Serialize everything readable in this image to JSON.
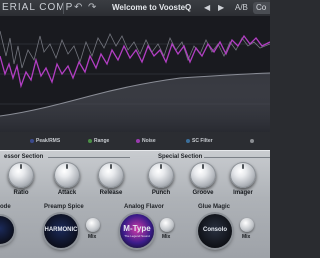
{
  "topbar": {
    "title": "ERIAL COMP",
    "undo_icon": "↶",
    "redo_icon": "↷",
    "preset": "Welcome to VoosteQ",
    "prev_icon": "◀",
    "next_icon": "▶",
    "ab_label": "A/B",
    "copy_label": "Co"
  },
  "meters": {
    "peak_label": "Peak/RMS",
    "range_label": "Range",
    "noise_label": "Noise",
    "sc_filter_label": "SC Filter",
    "colors": {
      "peak": "#3b4a8c",
      "range": "#4b8f46",
      "noise": "#9b3bb0",
      "sc": "#3b6f9b"
    }
  },
  "compressor": {
    "section_label": "essor Section",
    "knobs": [
      "Ratio",
      "Attack",
      "Release"
    ]
  },
  "special": {
    "section_label": "Special Section",
    "knobs": [
      "Punch",
      "Groove",
      "Imager"
    ]
  },
  "lower": {
    "mode_label": "ode",
    "preamp_label": "Preamp Spice",
    "analog_label": "Analog Flavor",
    "glue_label": "Glue Magic",
    "harmonic_text": "HARMONIC",
    "mtype_text": "M-Type",
    "mtype_sub": "The Legend Sound",
    "consolo_text": "Consolo",
    "mix_label": "Mix"
  }
}
